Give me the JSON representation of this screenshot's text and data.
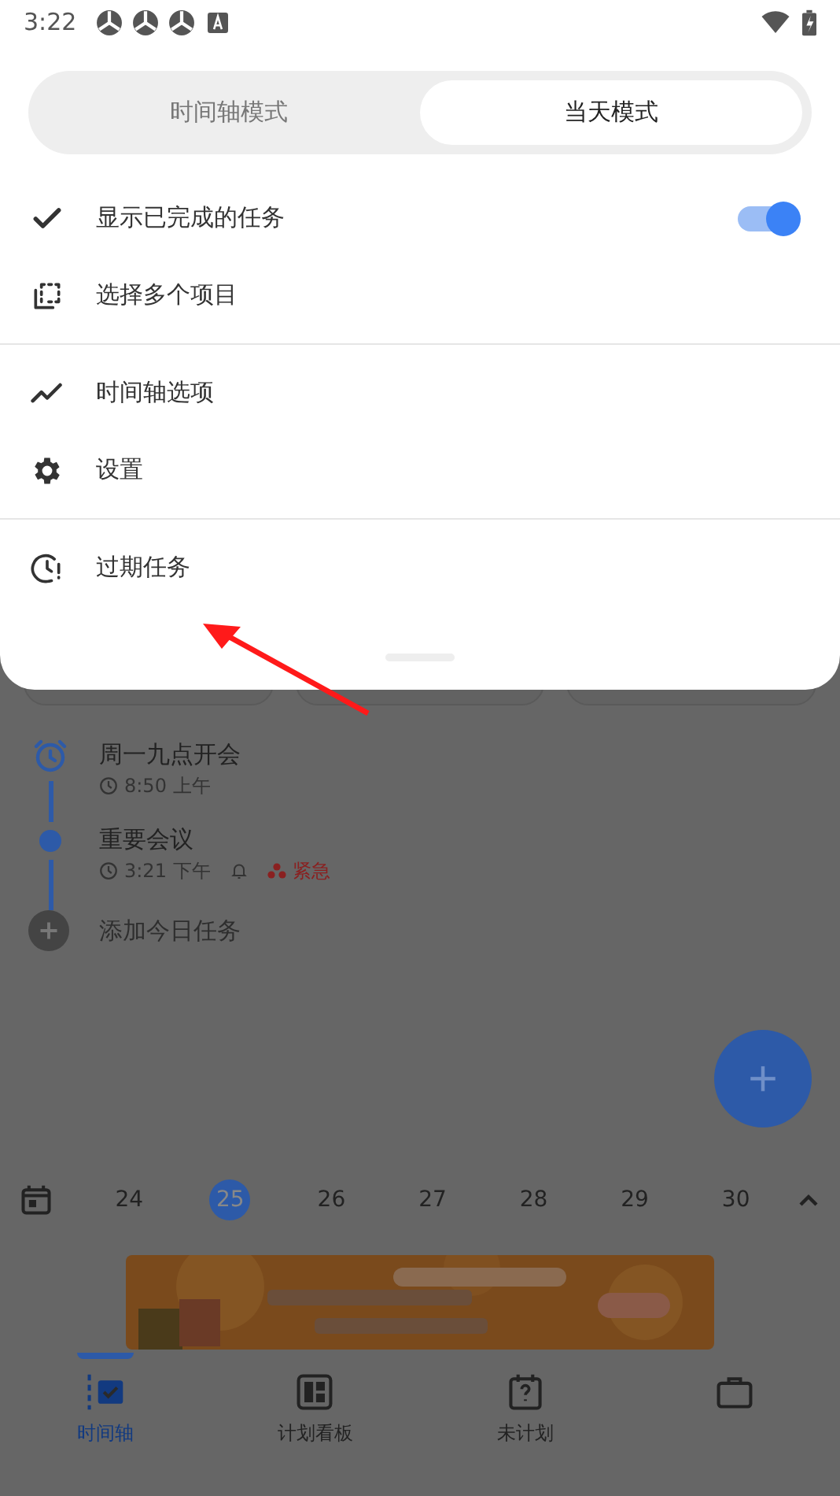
{
  "status_bar": {
    "time": "3:22"
  },
  "mode_tabs": [
    {
      "label": "时间轴模式",
      "selected": false
    },
    {
      "label": "当天模式",
      "selected": true
    }
  ],
  "menu_sections": [
    [
      {
        "kind": "toggle",
        "label": "显示已完成的任务",
        "on": true
      },
      {
        "kind": "item",
        "label": "选择多个项目"
      }
    ],
    [
      {
        "kind": "item",
        "label": "时间轴选项"
      },
      {
        "kind": "item",
        "label": "设置"
      }
    ],
    [
      {
        "kind": "item",
        "label": "过期任务"
      }
    ]
  ],
  "tasks": [
    {
      "kind": "alarm",
      "title": "周一九点开会",
      "time": "8:50 上午"
    },
    {
      "kind": "dot",
      "title": "重要会议",
      "time": "3:21 下午",
      "reminder": true,
      "priority": "紧急"
    }
  ],
  "add_task": "添加今日任务",
  "dates": [
    {
      "label": "24",
      "selected": false
    },
    {
      "label": "25",
      "selected": true
    },
    {
      "label": "26",
      "selected": false
    },
    {
      "label": "27",
      "selected": false
    },
    {
      "label": "28",
      "selected": false
    },
    {
      "label": "29",
      "selected": false
    },
    {
      "label": "30",
      "selected": false
    }
  ],
  "bottom_nav": [
    {
      "label": "时间轴",
      "selected": true
    },
    {
      "label": "计划看板",
      "selected": false
    },
    {
      "label": "未计划",
      "selected": false
    },
    {
      "selected": false
    }
  ]
}
